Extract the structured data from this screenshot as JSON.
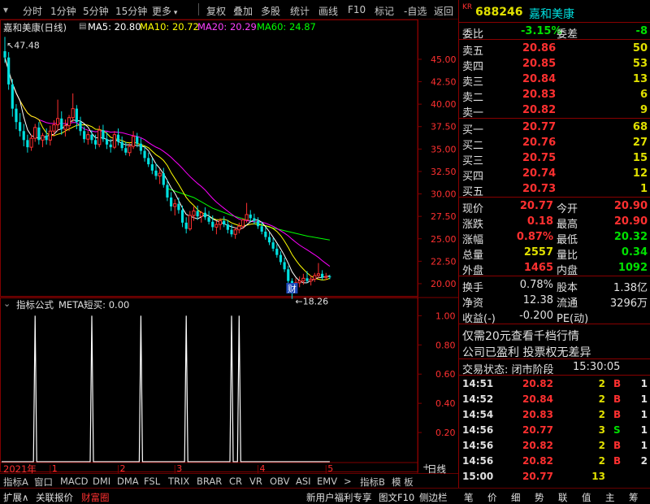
{
  "toolbar": {
    "items": [
      "分时",
      "1分钟",
      "5分钟",
      "15分钟",
      "更多",
      "复权",
      "叠加",
      "多股",
      "统计",
      "画线",
      "F10",
      "标记",
      "-自选",
      "返回"
    ]
  },
  "legend": {
    "title": "嘉和美康(日线)",
    "ma5": "MA5: 20.80",
    "ma10": "MA10: 20.72",
    "ma20": "MA20: 20.29",
    "ma60": "MA60: 24.87"
  },
  "colors": {
    "ma5": "#ffffff",
    "ma10": "#ffff00",
    "ma20": "#ff00ff",
    "ma60": "#00ff00",
    "up": "#ff3030",
    "down": "#00e0e0",
    "grid": "#800000"
  },
  "sub_legend": {
    "name": "指标公式",
    "value": "META短买: 0.00"
  },
  "chart_data": {
    "type": "candlestick",
    "annotations": {
      "high_label": "47.48",
      "low_label": "18.26",
      "marker": "财"
    },
    "y_ticks": [
      "45.00",
      "42.50",
      "40.00",
      "37.50",
      "35.00",
      "32.50",
      "30.00",
      "27.50",
      "25.00",
      "22.50",
      "20.00"
    ],
    "ylim": [
      19.0,
      47.8
    ],
    "x_labels": [
      {
        "label": "2021年",
        "index": 0
      },
      {
        "label": "1",
        "index": 12
      },
      {
        "label": "2",
        "index": 30
      },
      {
        "label": "3",
        "index": 45
      },
      {
        "label": "4",
        "index": 67
      },
      {
        "label": "5",
        "index": 85
      }
    ],
    "candles": [
      [
        45.9,
        47.5,
        44.6,
        45.2
      ],
      [
        45.2,
        45.8,
        41.6,
        42.2
      ],
      [
        42.2,
        42.8,
        38.6,
        39.5
      ],
      [
        39.5,
        40.0,
        37.2,
        38.0
      ],
      [
        38.0,
        39.0,
        36.4,
        37.0
      ],
      [
        37.0,
        37.8,
        35.3,
        36.0
      ],
      [
        36.0,
        36.6,
        34.6,
        35.2
      ],
      [
        35.2,
        36.6,
        34.8,
        36.2
      ],
      [
        36.2,
        37.8,
        35.8,
        37.4
      ],
      [
        37.4,
        38.0,
        35.5,
        36.0
      ],
      [
        36.0,
        36.8,
        35.2,
        36.5
      ],
      [
        36.5,
        37.3,
        35.5,
        36.0
      ],
      [
        36.0,
        37.6,
        35.4,
        37.0
      ],
      [
        37.0,
        38.2,
        36.4,
        37.7
      ],
      [
        37.7,
        40.5,
        37.0,
        38.4
      ],
      [
        38.4,
        39.2,
        36.6,
        37.2
      ],
      [
        37.2,
        38.3,
        36.4,
        37.6
      ],
      [
        37.6,
        38.8,
        37.0,
        38.5
      ],
      [
        38.5,
        41.2,
        38.0,
        39.5
      ],
      [
        39.5,
        39.9,
        37.2,
        38.0
      ],
      [
        38.0,
        38.6,
        36.5,
        37.0
      ],
      [
        37.0,
        37.5,
        35.7,
        36.1
      ],
      [
        36.1,
        37.0,
        35.5,
        36.6
      ],
      [
        36.6,
        37.1,
        35.6,
        36.0
      ],
      [
        36.0,
        36.6,
        35.0,
        35.5
      ],
      [
        35.5,
        37.6,
        35.2,
        37.1
      ],
      [
        37.1,
        37.7,
        35.8,
        36.1
      ],
      [
        36.1,
        36.9,
        35.0,
        35.5
      ],
      [
        35.5,
        36.1,
        34.6,
        35.2
      ],
      [
        35.2,
        37.0,
        35.0,
        36.6
      ],
      [
        36.6,
        37.3,
        35.4,
        35.8
      ],
      [
        35.8,
        36.4,
        34.8,
        35.1
      ],
      [
        35.1,
        35.8,
        34.3,
        34.6
      ],
      [
        34.6,
        35.6,
        34.2,
        35.3
      ],
      [
        35.3,
        37.0,
        35.0,
        36.4
      ],
      [
        36.4,
        36.8,
        35.2,
        35.6
      ],
      [
        35.6,
        36.2,
        34.4,
        34.8
      ],
      [
        34.8,
        35.3,
        33.6,
        34.0
      ],
      [
        34.0,
        34.6,
        33.0,
        33.3
      ],
      [
        33.3,
        34.0,
        32.2,
        32.6
      ],
      [
        32.6,
        33.4,
        31.6,
        32.0
      ],
      [
        32.0,
        32.8,
        31.1,
        32.3
      ],
      [
        32.3,
        32.9,
        30.7,
        31.0
      ],
      [
        31.0,
        31.6,
        29.2,
        29.6
      ],
      [
        29.6,
        30.2,
        28.1,
        28.6
      ],
      [
        28.6,
        29.4,
        27.6,
        28.9
      ],
      [
        28.9,
        29.6,
        27.8,
        28.2
      ],
      [
        28.2,
        28.7,
        26.3,
        26.8
      ],
      [
        26.8,
        27.4,
        25.6,
        26.1
      ],
      [
        26.1,
        28.1,
        25.9,
        27.6
      ],
      [
        27.6,
        28.6,
        27.0,
        28.1
      ],
      [
        28.1,
        28.7,
        27.1,
        27.5
      ],
      [
        27.5,
        28.1,
        26.8,
        27.9
      ],
      [
        27.9,
        28.5,
        27.1,
        27.4
      ],
      [
        27.4,
        28.1,
        26.6,
        26.9
      ],
      [
        26.9,
        27.6,
        25.9,
        26.3
      ],
      [
        26.3,
        27.0,
        25.5,
        26.6
      ],
      [
        26.6,
        27.3,
        26.0,
        27.0
      ],
      [
        27.0,
        27.5,
        26.3,
        26.6
      ],
      [
        26.6,
        27.1,
        25.6,
        26.0
      ],
      [
        26.0,
        26.6,
        25.2,
        25.5
      ],
      [
        25.5,
        26.3,
        25.0,
        26.0
      ],
      [
        26.0,
        26.8,
        25.6,
        26.4
      ],
      [
        26.4,
        27.3,
        26.1,
        27.1
      ],
      [
        27.1,
        29.0,
        26.8,
        27.7
      ],
      [
        27.7,
        28.2,
        26.9,
        27.3
      ],
      [
        27.3,
        27.8,
        26.6,
        27.0
      ],
      [
        27.0,
        27.4,
        26.1,
        26.4
      ],
      [
        26.4,
        26.9,
        25.5,
        25.8
      ],
      [
        25.8,
        26.3,
        24.9,
        25.2
      ],
      [
        25.2,
        25.7,
        24.3,
        24.6
      ],
      [
        24.6,
        25.1,
        23.6,
        23.9
      ],
      [
        23.9,
        24.4,
        22.9,
        23.2
      ],
      [
        23.2,
        23.6,
        22.1,
        22.4
      ],
      [
        22.4,
        22.9,
        21.3,
        21.6
      ],
      [
        21.6,
        22.0,
        20.0,
        20.3
      ],
      [
        20.3,
        20.6,
        18.3,
        19.2
      ],
      [
        19.2,
        20.6,
        19.0,
        20.1
      ],
      [
        20.1,
        20.8,
        19.6,
        20.3
      ],
      [
        20.3,
        21.1,
        19.9,
        20.6
      ],
      [
        20.6,
        21.4,
        20.1,
        20.3
      ],
      [
        20.3,
        20.9,
        19.8,
        20.5
      ],
      [
        20.5,
        21.2,
        20.2,
        20.9
      ],
      [
        20.9,
        22.3,
        20.6,
        21.1
      ],
      [
        21.1,
        21.5,
        20.4,
        20.7
      ],
      [
        20.7,
        21.2,
        20.4,
        20.8
      ],
      [
        20.8,
        21.0,
        20.5,
        20.77
      ]
    ],
    "ma60": [
      [
        43,
        30.6
      ],
      [
        50,
        29.6
      ],
      [
        55,
        28.4
      ],
      [
        60,
        27.6
      ],
      [
        65,
        27.0
      ],
      [
        70,
        26.3
      ],
      [
        75,
        25.8
      ],
      [
        80,
        25.3
      ],
      [
        86,
        24.87
      ]
    ],
    "sub_chart": {
      "ylim": [
        0,
        1.08
      ],
      "y_ticks": [
        "1.00",
        "0.80",
        "0.60",
        "0.40",
        "0.20"
      ],
      "spikes": [
        8,
        23,
        36,
        48,
        60,
        62
      ]
    }
  },
  "bottom_tabs": [
    "2021年",
    "指标A",
    "窗口",
    "MACD",
    "DMI",
    "DMA",
    "FSL",
    "TRIX",
    "BRAR",
    "CR",
    "VR",
    "OBV",
    "ASI",
    "EMV",
    ">",
    "指标B",
    "模 板",
    "+",
    "-",
    "日线"
  ],
  "status_bar": {
    "left": [
      "扩展∧",
      "关联报价",
      "财富圈"
    ],
    "promo": "新用户福利专享",
    "right": [
      "图文F10",
      "侧边栏"
    ],
    "nav": [
      "笔",
      "价",
      "细",
      "势",
      "联",
      "值",
      "主",
      "筹"
    ]
  },
  "stock": {
    "badge": "KR",
    "code": "688246",
    "name": "嘉和美康"
  },
  "quote": {
    "wb_label": "委比",
    "wb_value": "-3.15%",
    "wc_label": "委差",
    "wc_value": "-8",
    "asks": [
      {
        "label": "卖五",
        "price": "20.86",
        "vol": "50"
      },
      {
        "label": "卖四",
        "price": "20.85",
        "vol": "53"
      },
      {
        "label": "卖三",
        "price": "20.84",
        "vol": "13"
      },
      {
        "label": "卖二",
        "price": "20.83",
        "vol": "6"
      },
      {
        "label": "卖一",
        "price": "20.82",
        "vol": "9"
      }
    ],
    "bids": [
      {
        "label": "买一",
        "price": "20.77",
        "vol": "68"
      },
      {
        "label": "买二",
        "price": "20.76",
        "vol": "27"
      },
      {
        "label": "买三",
        "price": "20.75",
        "vol": "15"
      },
      {
        "label": "买四",
        "price": "20.74",
        "vol": "12"
      },
      {
        "label": "买五",
        "price": "20.73",
        "vol": "1"
      }
    ],
    "stats": [
      [
        {
          "label": "现价",
          "value": "20.77",
          "c": "red"
        },
        {
          "label": "今开",
          "value": "20.90",
          "c": "red"
        }
      ],
      [
        {
          "label": "涨跌",
          "value": "0.18",
          "c": "red"
        },
        {
          "label": "最高",
          "value": "20.90",
          "c": "red"
        }
      ],
      [
        {
          "label": "涨幅",
          "value": "0.87%",
          "c": "red"
        },
        {
          "label": "最低",
          "value": "20.32",
          "c": "green"
        }
      ],
      [
        {
          "label": "总量",
          "value": "2557",
          "c": "yellow"
        },
        {
          "label": "量比",
          "value": "0.34",
          "c": "green"
        }
      ],
      [
        {
          "label": "外盘",
          "value": "1465",
          "c": "red"
        },
        {
          "label": "内盘",
          "value": "1092",
          "c": "green"
        }
      ]
    ],
    "fin": [
      [
        {
          "label": "换手",
          "value": "0.78%"
        },
        {
          "label": "股本",
          "value": "1.38亿"
        }
      ],
      [
        {
          "label": "净资",
          "value": "12.38"
        },
        {
          "label": "流通",
          "value": "3296万"
        }
      ],
      [
        {
          "label": "收益(-)",
          "value": "-0.200"
        },
        {
          "label": "PE(动)",
          "value": ""
        }
      ]
    ],
    "promo1": "仅需20元查看千档行情",
    "promo2": "公司已盈利 投票权无差异",
    "trade_status_label": "交易状态: 闭市阶段",
    "trade_status_time": "15:30:05",
    "trades": [
      {
        "time": "14:51",
        "price": "20.82",
        "vol": "2",
        "side": "B",
        "n": "1"
      },
      {
        "time": "14:52",
        "price": "20.84",
        "vol": "2",
        "side": "B",
        "n": "1"
      },
      {
        "time": "14:54",
        "price": "20.83",
        "vol": "2",
        "side": "B",
        "n": "1"
      },
      {
        "time": "14:56",
        "price": "20.77",
        "vol": "3",
        "side": "S",
        "n": "1"
      },
      {
        "time": "14:56",
        "price": "20.82",
        "vol": "2",
        "side": "B",
        "n": "1"
      },
      {
        "time": "14:56",
        "price": "20.82",
        "vol": "2",
        "side": "B",
        "n": "2"
      },
      {
        "time": "15:00",
        "price": "20.77",
        "vol": "13",
        "side": "",
        "n": ""
      }
    ]
  }
}
